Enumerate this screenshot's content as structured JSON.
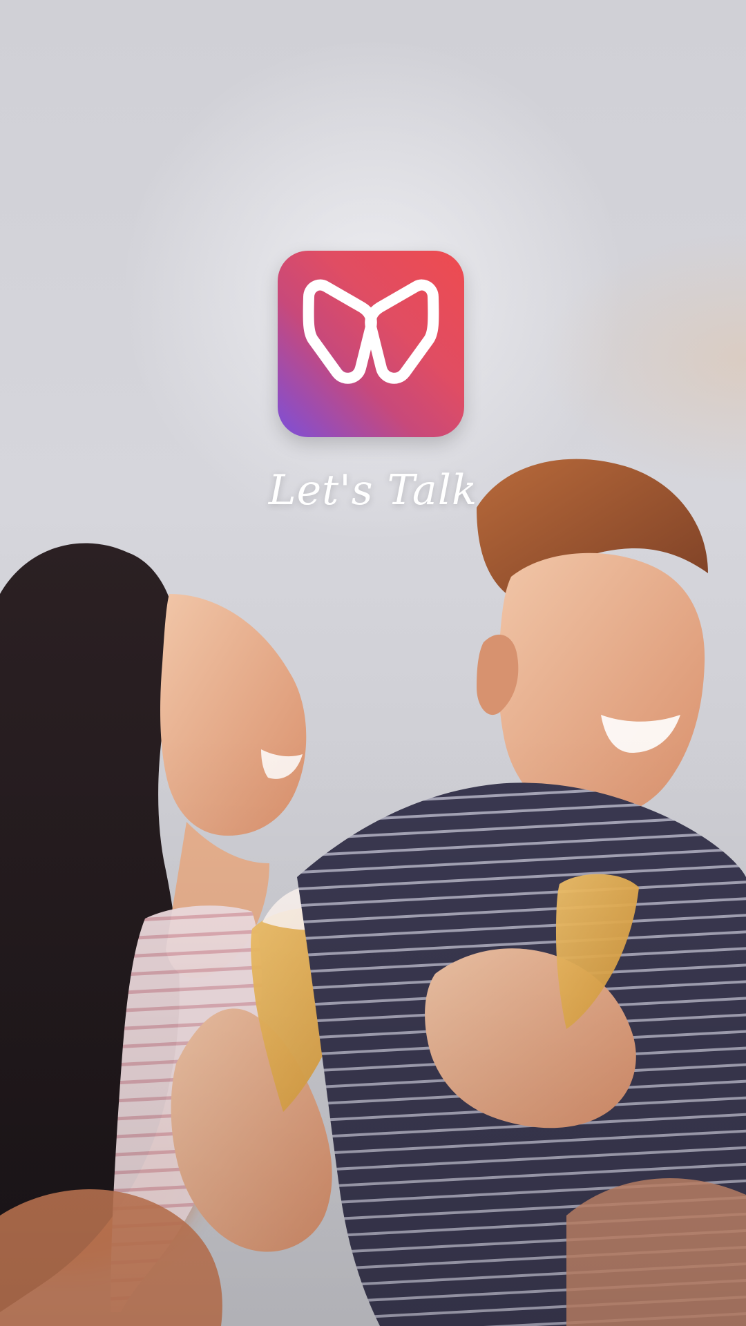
{
  "screen": {
    "tagline": "Let's Talk"
  },
  "icons": {
    "app_logo": "w-logo-icon"
  },
  "colors": {
    "logo_gradient_start": "#ee4b4f",
    "logo_gradient_mid": "#c8497a",
    "logo_gradient_end": "#7c4fd9",
    "tagline_text": "#ffffff"
  }
}
